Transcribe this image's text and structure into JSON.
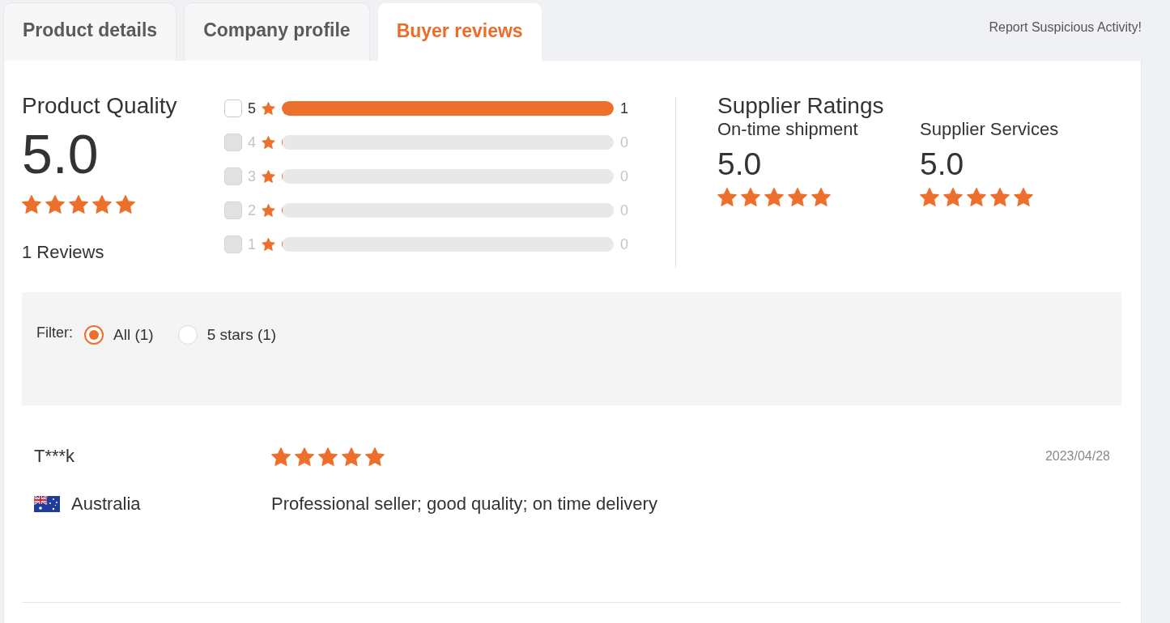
{
  "tabs": [
    {
      "label": "Product details",
      "selected": false
    },
    {
      "label": "Company profile",
      "selected": false
    },
    {
      "label": "Buyer reviews",
      "selected": true
    }
  ],
  "report_link": "Report Suspicious Activity!",
  "product_quality": {
    "title": "Product Quality",
    "score": "5.0",
    "stars": 5,
    "reviews_count": "1 Reviews"
  },
  "rating_breakdown": [
    {
      "label": "5",
      "checked": false,
      "disabled": false,
      "level": 1,
      "count": "1"
    },
    {
      "label": "4",
      "checked": false,
      "disabled": true,
      "level": 0,
      "count": "0"
    },
    {
      "label": "3",
      "checked": false,
      "disabled": true,
      "level": 0,
      "count": "0"
    },
    {
      "label": "2",
      "checked": false,
      "disabled": true,
      "level": 0,
      "count": "0"
    },
    {
      "label": "1",
      "checked": false,
      "disabled": true,
      "level": 0,
      "count": "0"
    }
  ],
  "supplier_ratings": {
    "title": "Supplier Ratings",
    "metrics": [
      {
        "label": "On-time shipment",
        "score": "5.0",
        "stars": 5
      },
      {
        "label": "Supplier Services",
        "score": "5.0",
        "stars": 5
      }
    ]
  },
  "filter": {
    "label": "Filter:",
    "options": [
      {
        "label": "All (1)",
        "selected": true
      },
      {
        "label": "5 stars (1)",
        "selected": false
      }
    ]
  },
  "reviews": [
    {
      "reviewer": "T***k",
      "stars": 5,
      "date": "2023/04/28",
      "country": "Australia",
      "comment": "Professional seller; good quality; on time delivery"
    }
  ]
}
